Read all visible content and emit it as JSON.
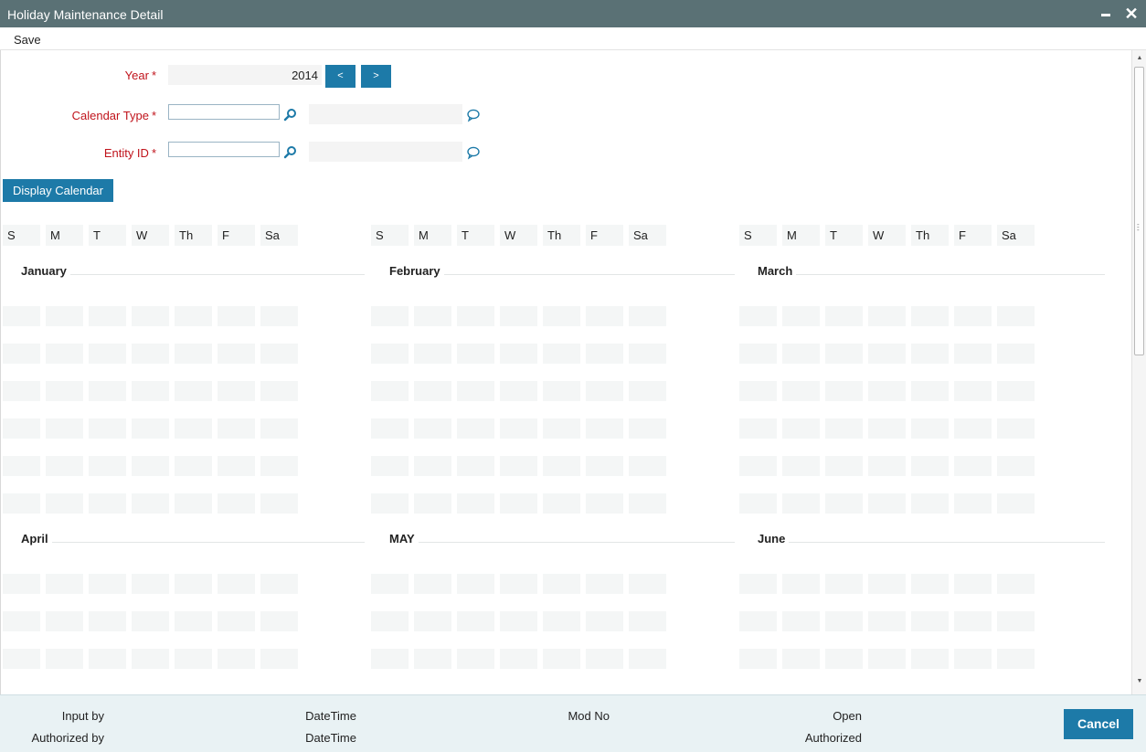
{
  "window": {
    "title": "Holiday Maintenance Detail",
    "close_glyph": "✕"
  },
  "toolbar": {
    "save_label": "Save"
  },
  "form": {
    "year": {
      "label": "Year",
      "required_mark": "*",
      "value": "2014",
      "prev_label": "<",
      "next_label": ">"
    },
    "calendar_type": {
      "label": "Calendar Type",
      "required_mark": "*",
      "value": "",
      "description": ""
    },
    "entity_id": {
      "label": "Entity ID",
      "required_mark": "*",
      "value": "",
      "description": ""
    },
    "display_button": "Display Calendar"
  },
  "calendar": {
    "weekdays": [
      "S",
      "M",
      "T",
      "W",
      "Th",
      "F",
      "Sa"
    ],
    "months": [
      "January",
      "February",
      "March",
      "April",
      "MAY",
      "June"
    ]
  },
  "icons": {
    "lookup": "search-icon",
    "description": "speech-bubble-icon"
  },
  "colors": {
    "titlebar": "#5a7175",
    "accent": "#1d7aa8",
    "required": "#c0141c",
    "footer": "#e9f2f4"
  },
  "footer": {
    "input_by": "Input by",
    "input_datetime": "DateTime",
    "mod_no": "Mod No",
    "open": "Open",
    "authorized_by": "Authorized by",
    "authorized_datetime": "DateTime",
    "authorized": "Authorized",
    "cancel_label": "Cancel"
  }
}
